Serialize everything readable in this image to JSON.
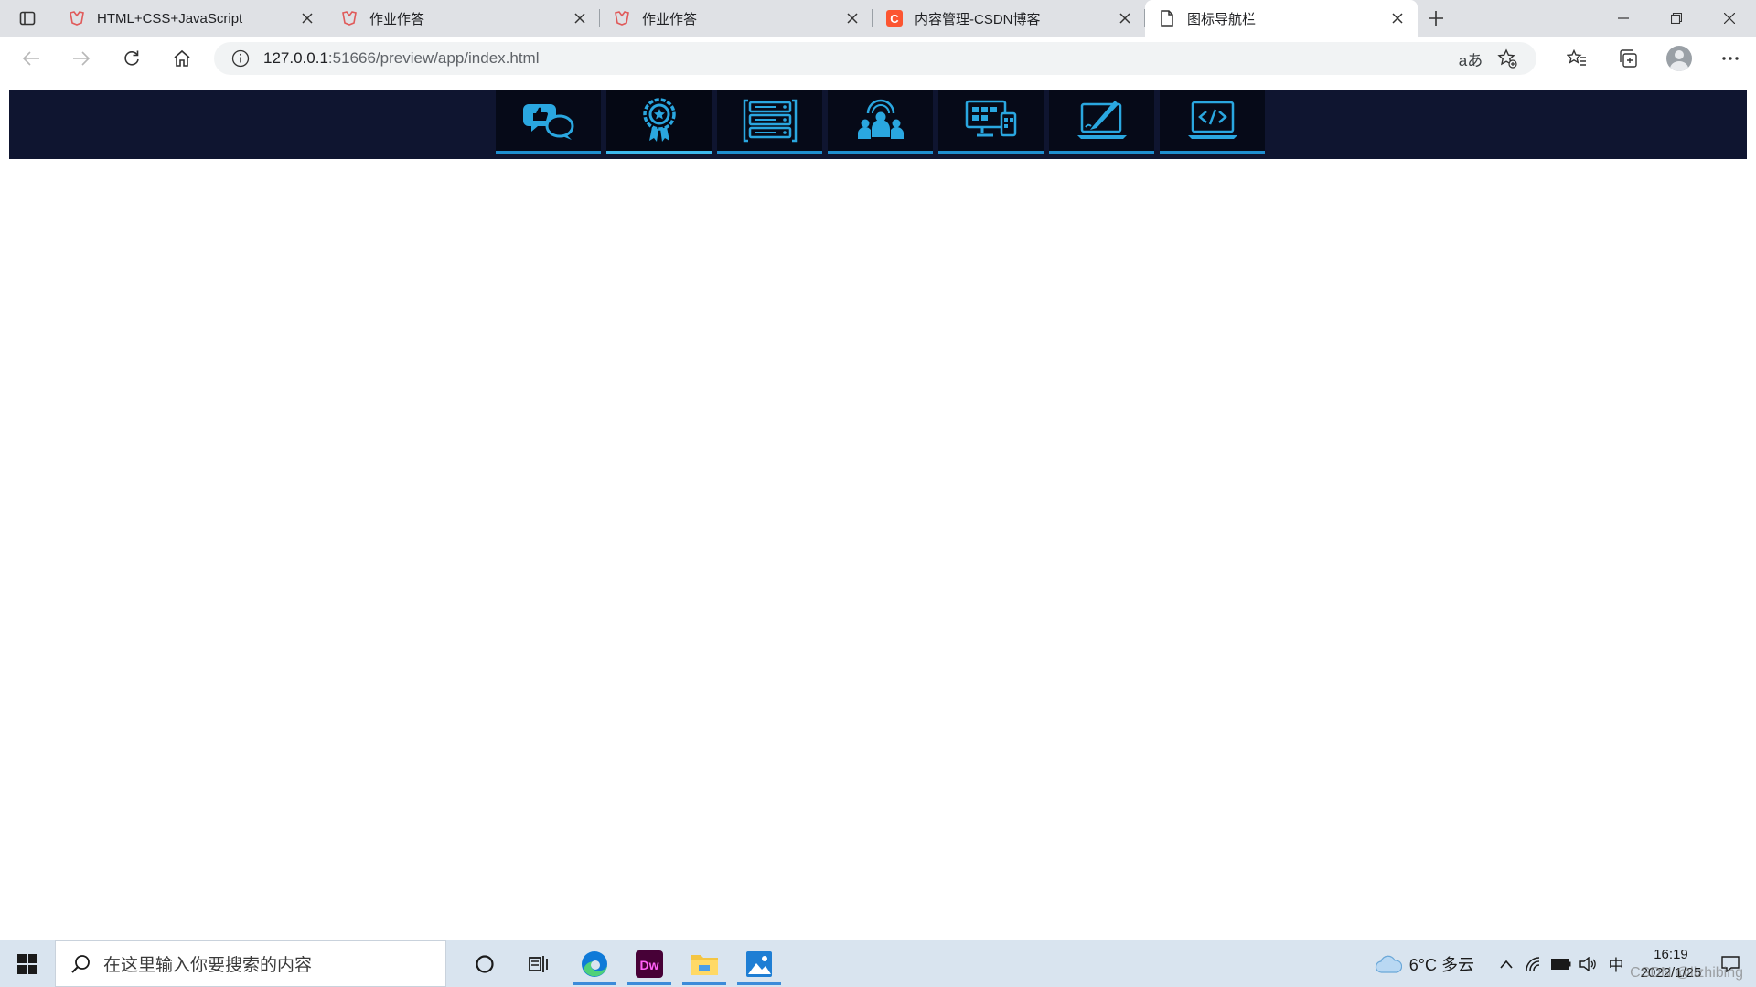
{
  "browser": {
    "tabs": [
      {
        "title": "HTML+CSS+JavaScript",
        "icon": "tab-logo-icon"
      },
      {
        "title": "作业作答",
        "icon": "tab-logo-icon"
      },
      {
        "title": "作业作答",
        "icon": "tab-logo-icon"
      },
      {
        "title": "内容管理-CSDN博客",
        "icon": "csdn-icon"
      },
      {
        "title": "图标导航栏",
        "icon": "page-icon",
        "active": true
      }
    ],
    "address": {
      "host": "127.0.0.1",
      "rest": ":51666/preview/app/index.html"
    },
    "read_aloud_glyph": "aあ"
  },
  "nav": {
    "items": [
      {
        "name": "chat-feedback-icon"
      },
      {
        "name": "award-badge-icon",
        "active": true
      },
      {
        "name": "server-list-icon"
      },
      {
        "name": "user-group-icon"
      },
      {
        "name": "devices-icon"
      },
      {
        "name": "design-laptop-icon"
      },
      {
        "name": "code-laptop-icon"
      }
    ],
    "colors": {
      "bar": "#0f1530",
      "tile": "#060a18",
      "accent": "#3cb9ee"
    }
  },
  "taskbar": {
    "search_placeholder": "在这里输入你要搜索的内容",
    "weather": "6°C 多云",
    "ime": "中",
    "time": "16:19",
    "date": "2022/1/25",
    "watermark": "CSDN @lizhibing"
  }
}
